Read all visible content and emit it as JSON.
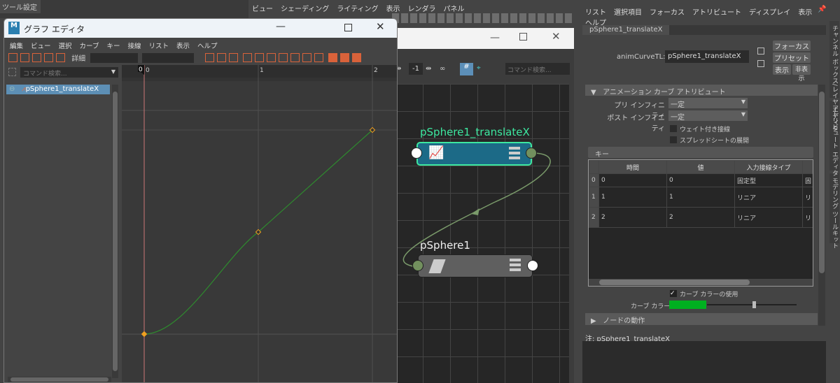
{
  "background": {
    "tool_settings_tab": "ツール設定",
    "viewport_menu": [
      "ビュー",
      "シェーディング",
      "ライティング",
      "表示",
      "レンダラ",
      "パネル"
    ]
  },
  "node_editor": {
    "offset_value": "-1",
    "search_placeholder": "コマンド検索...",
    "nodes": [
      {
        "name": "pSphere1_translateX",
        "type": "animCurve"
      },
      {
        "name": "pSphere1",
        "type": "transform"
      }
    ],
    "colors": {
      "anim_node": "#1c6a87",
      "anim_border": "#3de8a0",
      "transform_node": "#5f5f5f",
      "connection": "#7a9a6a"
    }
  },
  "graph_editor": {
    "title": "グラフ エディタ",
    "menu": [
      "編集",
      "ビュー",
      "選択",
      "カーブ",
      "キー",
      "接線",
      "リスト",
      "表示",
      "ヘルプ"
    ],
    "detail_label": "詳細",
    "search_placeholder": "コマンド検索...",
    "outliner_item": "pSphere1_translateX",
    "ruler": {
      "current_frame": "0",
      "ticks": [
        "0",
        "1",
        "2"
      ]
    },
    "keys": [
      {
        "time": 0,
        "value": 0
      },
      {
        "time": 1,
        "value": 1
      },
      {
        "time": 2,
        "value": 2
      }
    ],
    "curve_color": "#2e8b2e"
  },
  "attribute_editor": {
    "menu": [
      "リスト",
      "選択項目",
      "フォーカス",
      "アトリビュート",
      "ディスプレイ",
      "表示",
      "ヘルプ"
    ],
    "tab": "pSphere1_translateX",
    "node_type_label": "animCurveTL:",
    "node_name": "pSphere1_translateX",
    "buttons": {
      "focus": "フォーカス",
      "preset": "プリセット",
      "show": "表示",
      "hide": "非表示"
    },
    "section_title": "アニメーション カーブ アトリビュート",
    "pre_infinity_label": "プリ インフィニティ",
    "pre_infinity": "一定",
    "post_infinity_label": "ポスト インフィニティ",
    "post_infinity": "一定",
    "weighted_tangents": "ウェイト付き接線",
    "expand_spreadsheet": "スプレッドシートの展開",
    "keys_section": "キー",
    "table": {
      "headers": [
        "時間",
        "値",
        "入力接線タイプ"
      ],
      "rows": [
        {
          "index": "0",
          "time": "0",
          "value": "0",
          "in_tangent": "固定型",
          "out": "固"
        },
        {
          "index": "1",
          "time": "1",
          "value": "1",
          "in_tangent": "リニア",
          "out": "リ"
        },
        {
          "index": "2",
          "time": "2",
          "value": "2",
          "in_tangent": "リニア",
          "out": "リ"
        }
      ]
    },
    "use_curve_color": "カーブ カラーの使用",
    "use_curve_color_checked": true,
    "curve_color_label": "カーブ カラー",
    "curve_color": "#00b020",
    "curve_color_slider": 0.7,
    "node_behavior": "ノードの動作",
    "notes": "注: pSphere1_translateX"
  },
  "side_tabs": [
    "チャンネル ボックス/レイヤ エディタ",
    "アトリビュート エディタ",
    "モデリング ツールキット"
  ]
}
